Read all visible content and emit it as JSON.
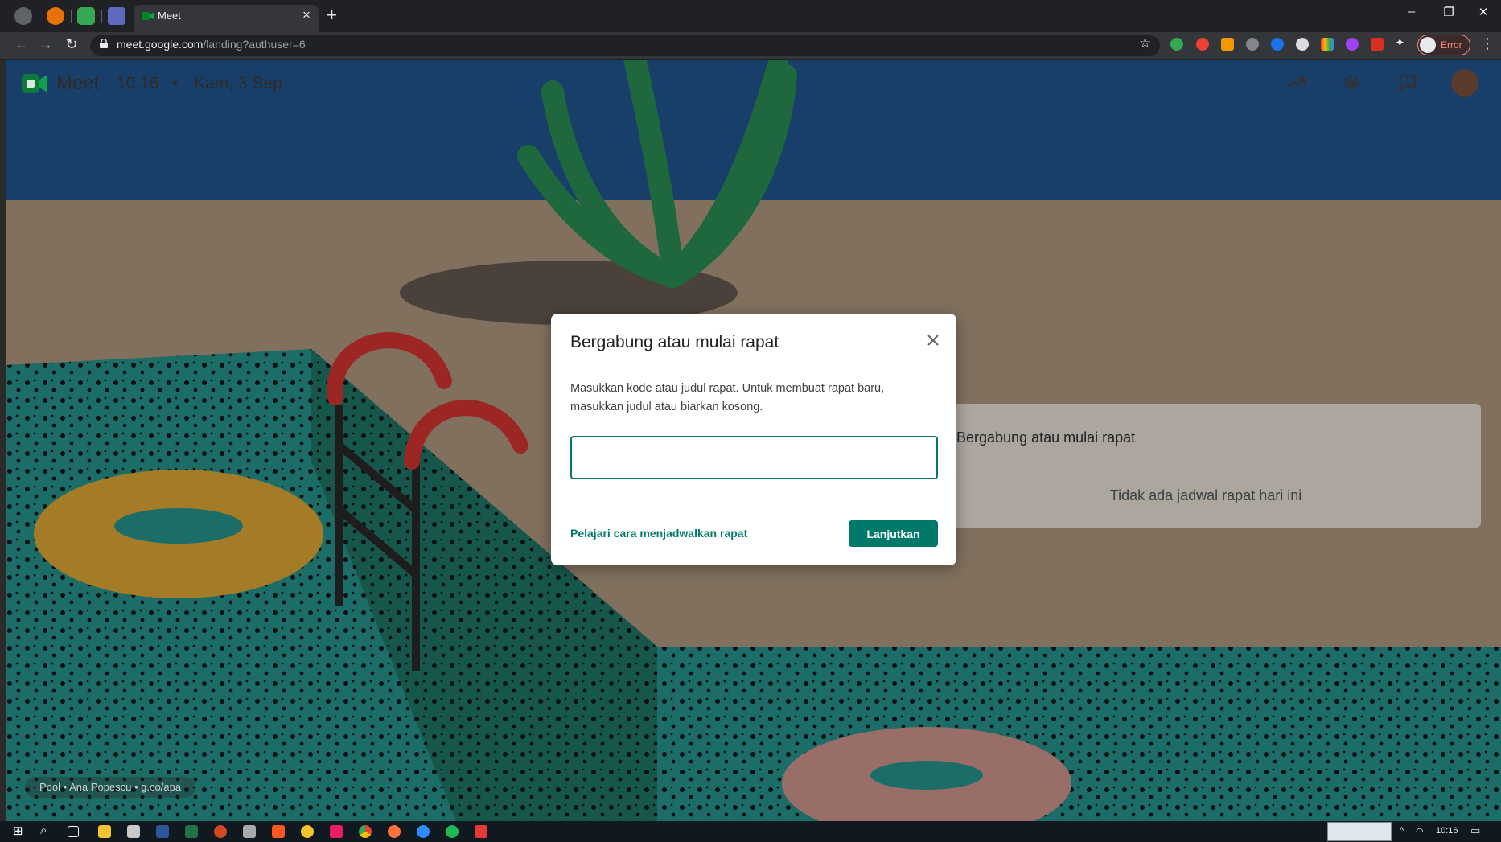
{
  "browser": {
    "tab_title": "Meet",
    "tab_close": "×",
    "new_tab": "+",
    "url_host": "meet.google.com",
    "url_path": "/landing?authuser=6",
    "profile_status": "Error",
    "window_controls": [
      "–",
      "❐",
      "✕"
    ]
  },
  "header": {
    "app_name": "Meet",
    "time": "10.16",
    "separator": "•",
    "date": "Kam, 3 Sep"
  },
  "background_card": {
    "title": "Bergabung atau mulai rapat",
    "empty_message": "Tidak ada jadwal rapat hari ini"
  },
  "credit": {
    "text": "Pool  •  Ana Popescu  •  g.co/apa"
  },
  "dialog": {
    "title": "Bergabung atau mulai rapat",
    "description": "Masukkan kode atau judul rapat. Untuk membuat rapat baru, masukkan judul atau biarkan kosong.",
    "input_value": "",
    "learn_link": "Pelajari cara menjadwalkan rapat",
    "continue_button": "Lanjutkan"
  },
  "taskbar": {
    "clock": "10:16",
    "tray_up": "^"
  },
  "colors": {
    "accent": "#00796b",
    "chrome_dark": "#202124"
  }
}
